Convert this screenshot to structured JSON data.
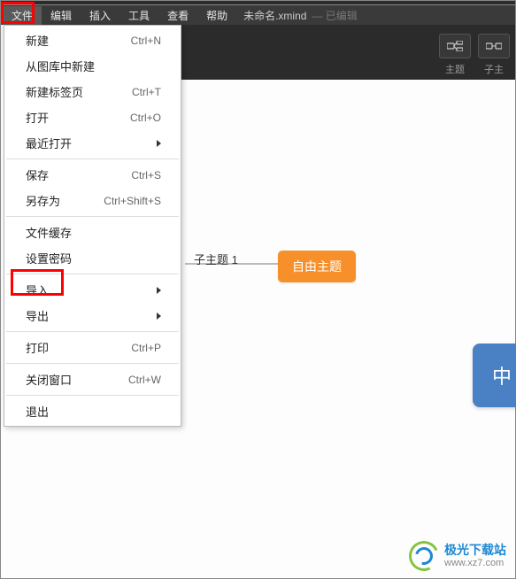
{
  "menubar": {
    "file": "文件",
    "edit": "编辑",
    "insert": "插入",
    "tools": "工具",
    "view": "查看",
    "help": "帮助"
  },
  "title": {
    "filename": "未命名.xmind",
    "edited": "— 已编辑"
  },
  "toolbar": {
    "topic": "主题",
    "subtopic": "子主"
  },
  "fileMenu": {
    "new": "新建",
    "newShortcut": "Ctrl+N",
    "newFromLib": "从图库中新建",
    "newTab": "新建标签页",
    "newTabShortcut": "Ctrl+T",
    "open": "打开",
    "openShortcut": "Ctrl+O",
    "recent": "最近打开",
    "save": "保存",
    "saveShortcut": "Ctrl+S",
    "saveAs": "另存为",
    "saveAsShortcut": "Ctrl+Shift+S",
    "cache": "文件缓存",
    "setPwd": "设置密码",
    "import": "导入",
    "export": "导出",
    "print": "打印",
    "printShortcut": "Ctrl+P",
    "closeWin": "关闭窗口",
    "closeWinShortcut": "Ctrl+W",
    "exit": "退出"
  },
  "canvas": {
    "subtopic1": "子主题 1",
    "freeTopic": "自由主题",
    "centerPartial": "中"
  },
  "watermark": {
    "cn": "极光下载站",
    "url": "www.xz7.com"
  }
}
